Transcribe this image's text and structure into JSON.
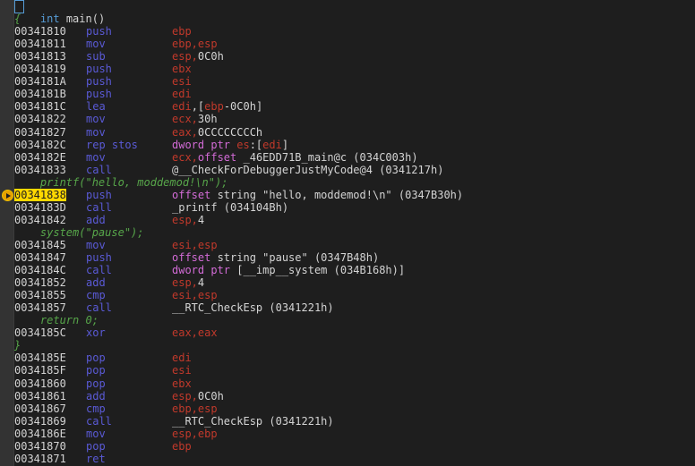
{
  "header": {
    "keyword": "int",
    "func": " main()"
  },
  "lines": [
    {
      "type": "src",
      "text": "{"
    },
    {
      "type": "asm",
      "addr": "00341810",
      "mn": "push",
      "ops": [
        {
          "c": "reg",
          "t": "ebp"
        }
      ]
    },
    {
      "type": "asm",
      "addr": "00341811",
      "mn": "mov",
      "ops": [
        {
          "c": "reg",
          "t": "ebp,esp"
        }
      ]
    },
    {
      "type": "asm",
      "addr": "00341813",
      "mn": "sub",
      "ops": [
        {
          "c": "reg",
          "t": "esp,"
        },
        {
          "c": "num",
          "t": "0C0h"
        }
      ]
    },
    {
      "type": "asm",
      "addr": "00341819",
      "mn": "push",
      "ops": [
        {
          "c": "reg",
          "t": "ebx"
        }
      ]
    },
    {
      "type": "asm",
      "addr": "0034181A",
      "mn": "push",
      "ops": [
        {
          "c": "reg",
          "t": "esi"
        }
      ]
    },
    {
      "type": "asm",
      "addr": "0034181B",
      "mn": "push",
      "ops": [
        {
          "c": "reg",
          "t": "edi"
        }
      ]
    },
    {
      "type": "asm",
      "addr": "0034181C",
      "mn": "lea",
      "ops": [
        {
          "c": "reg",
          "t": "edi"
        },
        {
          "c": "num",
          "t": ",["
        },
        {
          "c": "reg",
          "t": "ebp"
        },
        {
          "c": "num",
          "t": "-0C0h]"
        }
      ]
    },
    {
      "type": "asm",
      "addr": "00341822",
      "mn": "mov",
      "ops": [
        {
          "c": "reg",
          "t": "ecx,"
        },
        {
          "c": "num",
          "t": "30h"
        }
      ]
    },
    {
      "type": "asm",
      "addr": "00341827",
      "mn": "mov",
      "ops": [
        {
          "c": "reg",
          "t": "eax,"
        },
        {
          "c": "num",
          "t": "0CCCCCCCCh"
        }
      ]
    },
    {
      "type": "asm",
      "addr": "0034182C",
      "mn": "rep stos",
      "ops": [
        {
          "c": "ptr",
          "t": "dword ptr "
        },
        {
          "c": "reg",
          "t": "es"
        },
        {
          "c": "num",
          "t": ":["
        },
        {
          "c": "reg",
          "t": "edi"
        },
        {
          "c": "num",
          "t": "]"
        }
      ]
    },
    {
      "type": "asm",
      "addr": "0034182E",
      "mn": "mov",
      "ops": [
        {
          "c": "reg",
          "t": "ecx,"
        },
        {
          "c": "ptr",
          "t": "offset"
        },
        {
          "c": "num",
          "t": " _46EDD71B_main@c (034C003h)"
        }
      ]
    },
    {
      "type": "asm",
      "addr": "00341833",
      "mn": "call",
      "ops": [
        {
          "c": "num",
          "t": "@__CheckForDebuggerJustMyCode@4 (0341217h)"
        }
      ]
    },
    {
      "type": "src",
      "text": "    printf(\"hello, moddemod!\\n\");"
    },
    {
      "type": "asm",
      "addr": "00341838",
      "mn": "push",
      "current": true,
      "ops": [
        {
          "c": "ptr",
          "t": "offset"
        },
        {
          "c": "num",
          "t": " string \"hello, moddemod!\\n\" (0347B30h)"
        }
      ]
    },
    {
      "type": "asm",
      "addr": "0034183D",
      "mn": "call",
      "ops": [
        {
          "c": "num",
          "t": "_printf (034104Bh)"
        }
      ]
    },
    {
      "type": "asm",
      "addr": "00341842",
      "mn": "add",
      "ops": [
        {
          "c": "reg",
          "t": "esp,"
        },
        {
          "c": "num",
          "t": "4"
        }
      ]
    },
    {
      "type": "src",
      "text": "    system(\"pause\");"
    },
    {
      "type": "asm",
      "addr": "00341845",
      "mn": "mov",
      "ops": [
        {
          "c": "reg",
          "t": "esi,esp"
        }
      ]
    },
    {
      "type": "asm",
      "addr": "00341847",
      "mn": "push",
      "ops": [
        {
          "c": "ptr",
          "t": "offset"
        },
        {
          "c": "num",
          "t": " string \"pause\" (0347B48h)"
        }
      ]
    },
    {
      "type": "asm",
      "addr": "0034184C",
      "mn": "call",
      "ops": [
        {
          "c": "ptr",
          "t": "dword ptr"
        },
        {
          "c": "num",
          "t": " [__imp__system (034B168h)]"
        }
      ]
    },
    {
      "type": "asm",
      "addr": "00341852",
      "mn": "add",
      "ops": [
        {
          "c": "reg",
          "t": "esp,"
        },
        {
          "c": "num",
          "t": "4"
        }
      ]
    },
    {
      "type": "asm",
      "addr": "00341855",
      "mn": "cmp",
      "ops": [
        {
          "c": "reg",
          "t": "esi,esp"
        }
      ]
    },
    {
      "type": "asm",
      "addr": "00341857",
      "mn": "call",
      "ops": [
        {
          "c": "num",
          "t": "__RTC_CheckEsp (0341221h)"
        }
      ]
    },
    {
      "type": "src",
      "text": "    return 0;"
    },
    {
      "type": "asm",
      "addr": "0034185C",
      "mn": "xor",
      "ops": [
        {
          "c": "reg",
          "t": "eax,eax"
        }
      ]
    },
    {
      "type": "src",
      "text": "}"
    },
    {
      "type": "asm",
      "addr": "0034185E",
      "mn": "pop",
      "ops": [
        {
          "c": "reg",
          "t": "edi"
        }
      ]
    },
    {
      "type": "asm",
      "addr": "0034185F",
      "mn": "pop",
      "ops": [
        {
          "c": "reg",
          "t": "esi"
        }
      ]
    },
    {
      "type": "asm",
      "addr": "00341860",
      "mn": "pop",
      "ops": [
        {
          "c": "reg",
          "t": "ebx"
        }
      ]
    },
    {
      "type": "asm",
      "addr": "00341861",
      "mn": "add",
      "ops": [
        {
          "c": "reg",
          "t": "esp,"
        },
        {
          "c": "num",
          "t": "0C0h"
        }
      ]
    },
    {
      "type": "asm",
      "addr": "00341867",
      "mn": "cmp",
      "ops": [
        {
          "c": "reg",
          "t": "ebp,esp"
        }
      ]
    },
    {
      "type": "asm",
      "addr": "00341869",
      "mn": "call",
      "ops": [
        {
          "c": "num",
          "t": "__RTC_CheckEsp (0341221h)"
        }
      ]
    },
    {
      "type": "asm",
      "addr": "0034186E",
      "mn": "mov",
      "ops": [
        {
          "c": "reg",
          "t": "esp,ebp"
        }
      ]
    },
    {
      "type": "asm",
      "addr": "00341870",
      "mn": "pop",
      "ops": [
        {
          "c": "reg",
          "t": "ebp"
        }
      ]
    },
    {
      "type": "asm",
      "addr": "00341871",
      "mn": "ret",
      "ops": []
    }
  ],
  "colors": {
    "mnemonic": "#5a5ad6",
    "register": "#c0392b",
    "pointer": "#d26bd6",
    "source": "#57a64a",
    "current_addr": "#ffd800"
  },
  "icons": {
    "current_instruction": "instruction-pointer-arrow-icon"
  }
}
